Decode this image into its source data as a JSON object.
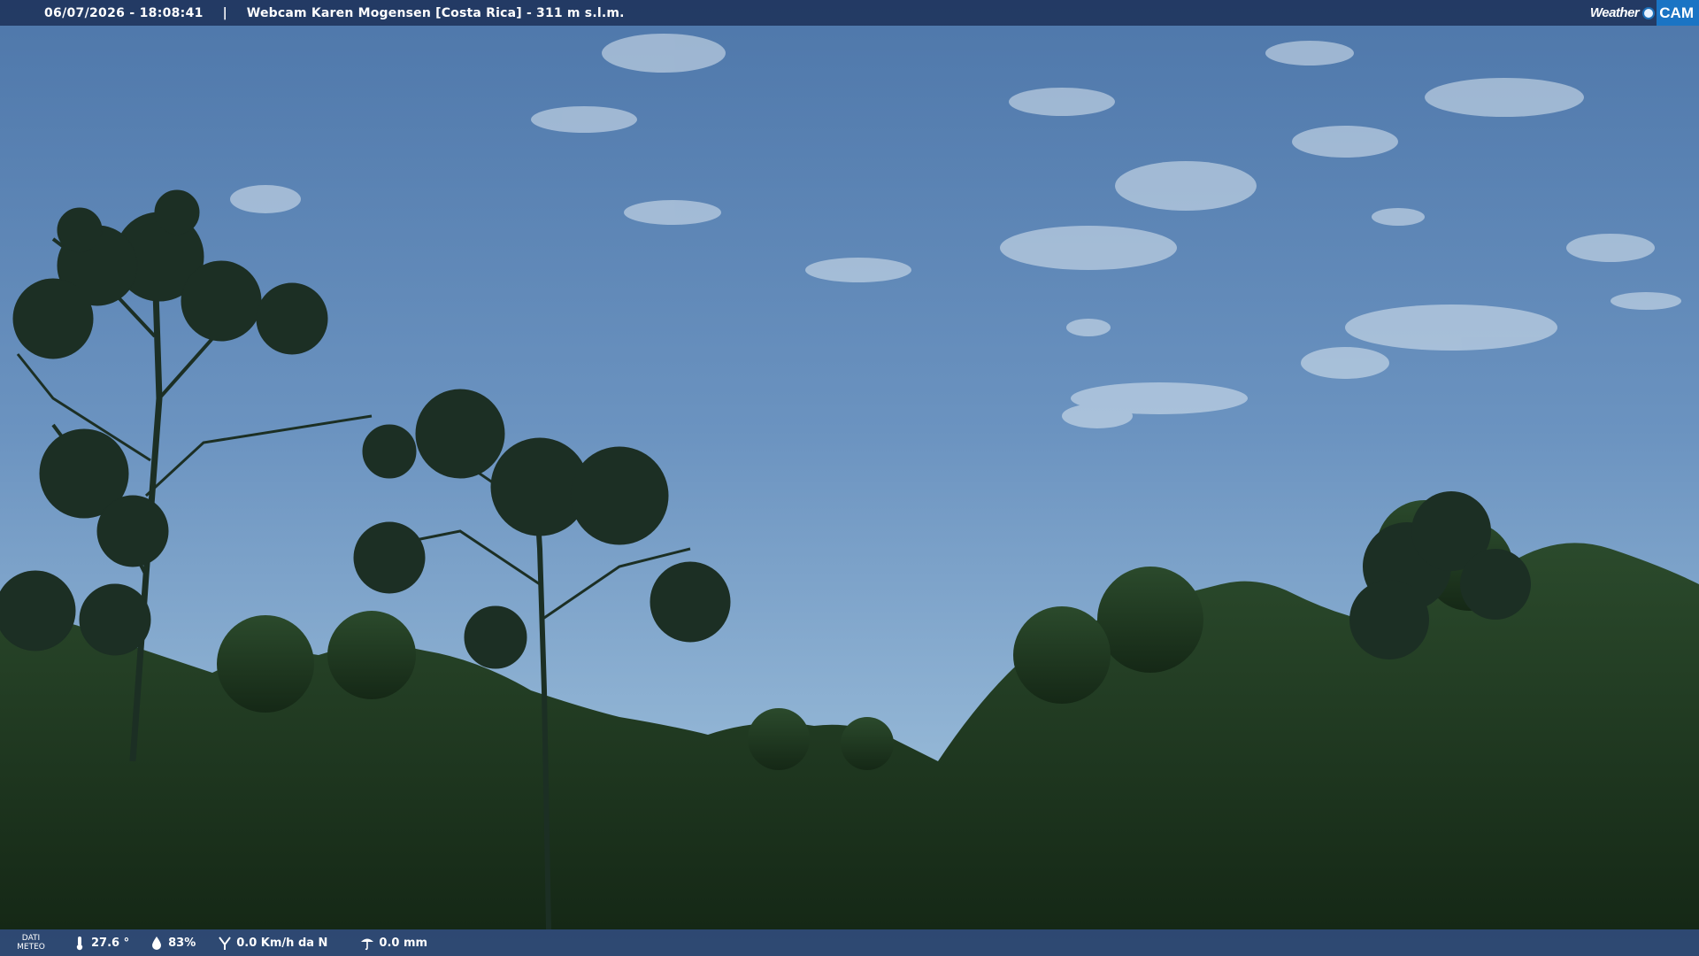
{
  "header": {
    "datetime": "06/07/2026 - 18:08:41",
    "separator": "|",
    "title": "Webcam Karen Mogensen [Costa Rica]  - 311 m s.l.m.",
    "logo_text_left": "Weather",
    "logo_text_right": "CAM"
  },
  "footer": {
    "label_line1": "DATI",
    "label_line2": "METEO",
    "temperature": "27.6 °",
    "humidity": "83%",
    "wind": "0.0 Km/h da N",
    "rain": "0.0 mm"
  },
  "icons": [
    "thermometer-icon",
    "humidity-icon",
    "wind-icon",
    "rain-icon"
  ],
  "colors": {
    "sky_top": "#4f79ab",
    "sky_bottom": "#9fbfd8",
    "vegetation": "#1f3520",
    "bar": "#1e325a",
    "logo_accent": "#1a74c4"
  }
}
